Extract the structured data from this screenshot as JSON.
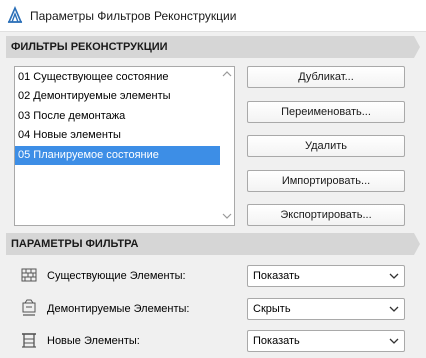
{
  "window": {
    "title": "Параметры Фильтров Реконструкции"
  },
  "filters_section": {
    "header": "ФИЛЬТРЫ РЕКОНСТРУКЦИИ",
    "items": [
      {
        "label": "01 Существующее состояние",
        "selected": false
      },
      {
        "label": "02 Демонтируемые элементы",
        "selected": false
      },
      {
        "label": "03 После демонтажа",
        "selected": false
      },
      {
        "label": "04 Новые элементы",
        "selected": false
      },
      {
        "label": "05 Планируемое состояние",
        "selected": true
      }
    ],
    "buttons": {
      "duplicate": "Дубликат...",
      "rename": "Переименовать...",
      "delete": "Удалить",
      "import": "Импортировать...",
      "export": "Экспортировать..."
    }
  },
  "params_section": {
    "header": "ПАРАМЕТРЫ ФИЛЬТРА",
    "rows": [
      {
        "label": "Существующие Элементы:",
        "icon": "existing-elements-icon",
        "value": "Показать"
      },
      {
        "label": "Демонтируемые Элементы:",
        "icon": "demolished-elements-icon",
        "value": "Скрыть"
      },
      {
        "label": "Новые Элементы:",
        "icon": "new-elements-icon",
        "value": "Показать"
      }
    ]
  },
  "colors": {
    "selection": "#3d8ee6",
    "header_bg": "#d6d6d6",
    "window_bg": "#f0f0f0"
  }
}
